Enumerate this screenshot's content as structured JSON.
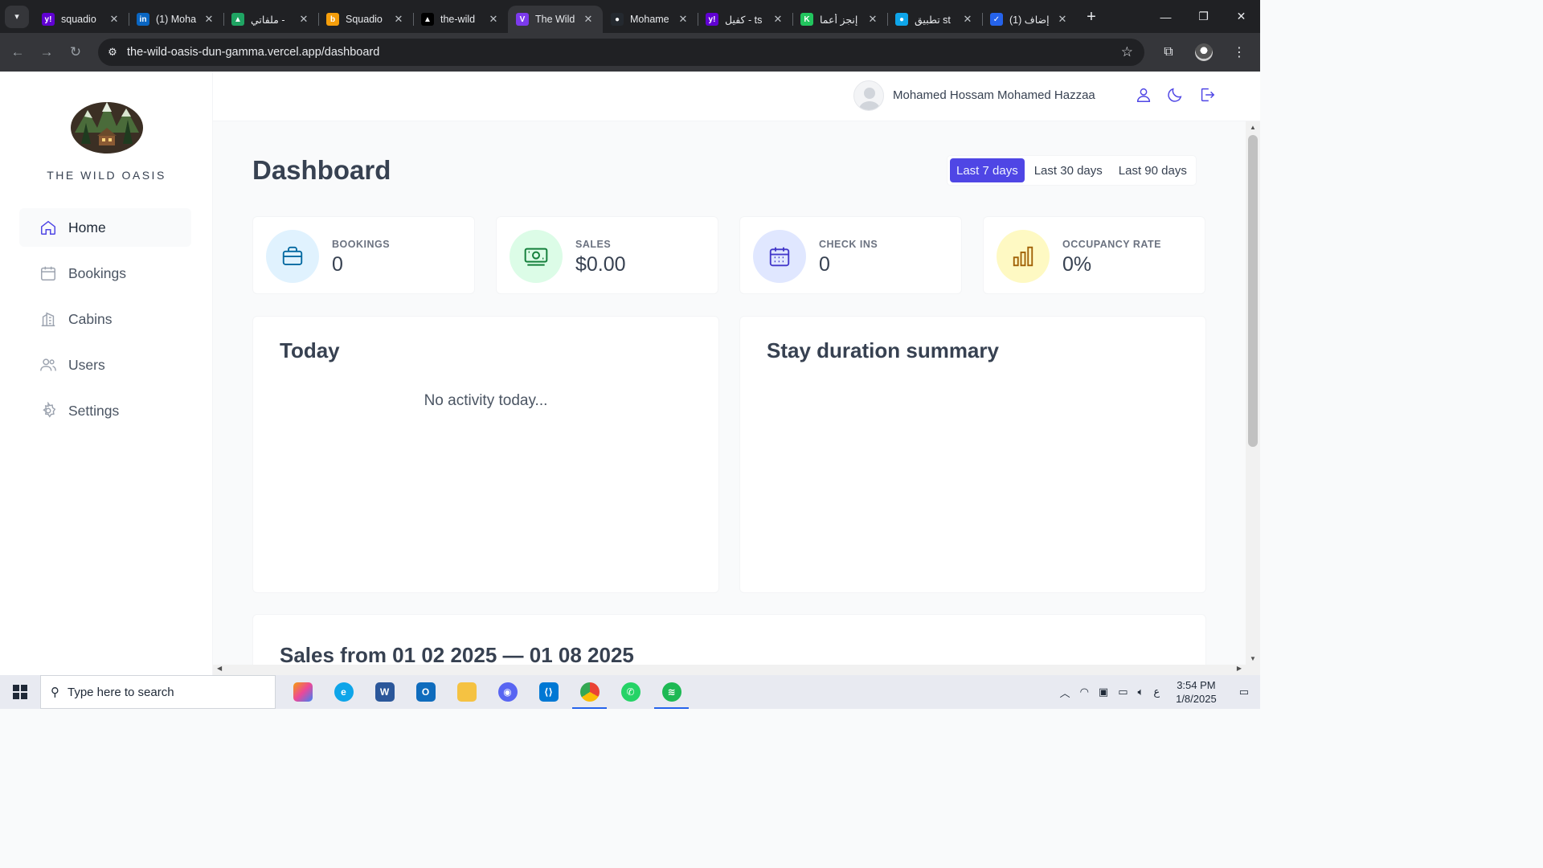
{
  "browser": {
    "tabs": [
      {
        "title": "squadio",
        "favicon": "yahoo-icon",
        "color": "#6001d2",
        "glyph": "y!",
        "active": false
      },
      {
        "title": "(1) Moha",
        "favicon": "linkedin-icon",
        "color": "#0a66c2",
        "glyph": "in",
        "active": false
      },
      {
        "title": "ملفاتي -",
        "favicon": "google-drive-icon",
        "color": "#1fa463",
        "glyph": "▲",
        "active": false
      },
      {
        "title": "Squadio",
        "favicon": "squadio-icon",
        "color": "#f59e0b",
        "glyph": "b",
        "active": false
      },
      {
        "title": "the-wild",
        "favicon": "vercel-icon",
        "color": "#000000",
        "glyph": "▲",
        "active": false
      },
      {
        "title": "The Wild",
        "favicon": "vite-icon",
        "color": "#7c3aed",
        "glyph": "V",
        "active": true
      },
      {
        "title": "Mohame",
        "favicon": "github-icon",
        "color": "#24292f",
        "glyph": "●",
        "active": false
      },
      {
        "title": "كفيل - ts",
        "favicon": "yahoo-icon",
        "color": "#6001d2",
        "glyph": "y!",
        "active": false
      },
      {
        "title": "إنجز أعما",
        "favicon": "khamsat-icon",
        "color": "#22c55e",
        "glyph": "K",
        "active": false
      },
      {
        "title": "تطبيق st",
        "favicon": "app-icon",
        "color": "#0ea5e9",
        "glyph": "●",
        "active": false
      },
      {
        "title": "(1) إضاف",
        "favicon": "mostaql-icon",
        "color": "#2563eb",
        "glyph": "✓",
        "active": false
      }
    ],
    "url": "the-wild-oasis-dun-gamma.vercel.app/dashboard"
  },
  "sidebar": {
    "logo_text": "THE WILD OASIS",
    "items": [
      {
        "label": "Home",
        "icon": "home-icon",
        "active": true
      },
      {
        "label": "Bookings",
        "icon": "calendar-icon",
        "active": false
      },
      {
        "label": "Cabins",
        "icon": "cabins-icon",
        "active": false
      },
      {
        "label": "Users",
        "icon": "users-icon",
        "active": false
      },
      {
        "label": "Settings",
        "icon": "settings-icon",
        "active": false
      }
    ]
  },
  "header": {
    "user_name": "Mohamed Hossam Mohamed Hazzaa"
  },
  "main": {
    "title": "Dashboard",
    "filters": [
      {
        "label": "Last 7 days",
        "active": true
      },
      {
        "label": "Last 30 days",
        "active": false
      },
      {
        "label": "Last 90 days",
        "active": false
      }
    ],
    "stats": [
      {
        "label": "BOOKINGS",
        "value": "0",
        "icon": "briefcase-icon",
        "bg": "#e0f2fe",
        "fg": "#0369a1"
      },
      {
        "label": "SALES",
        "value": "$0.00",
        "icon": "banknotes-icon",
        "bg": "#dcfce7",
        "fg": "#15803d"
      },
      {
        "label": "CHECK INS",
        "value": "0",
        "icon": "calendar-days-icon",
        "bg": "#e0e7ff",
        "fg": "#4338ca"
      },
      {
        "label": "OCCUPANCY RATE",
        "value": "0%",
        "icon": "chart-bar-icon",
        "bg": "#fef9c3",
        "fg": "#a16207"
      }
    ],
    "today": {
      "title": "Today",
      "empty": "No activity today..."
    },
    "stay": {
      "title": "Stay duration summary"
    },
    "sales": {
      "title": "Sales from 01 02 2025 — 01 08 2025"
    }
  },
  "taskbar": {
    "search_placeholder": "Type here to search",
    "time": "3:54 PM",
    "date": "1/8/2025",
    "lang": "ع"
  },
  "colors": {
    "accent": "#4f46e5"
  }
}
